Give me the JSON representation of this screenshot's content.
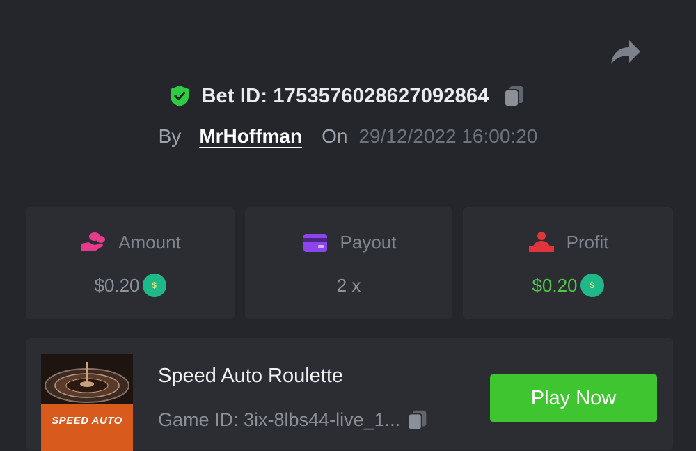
{
  "bet": {
    "id_label": "Bet ID: 1753576028627092864",
    "by_label": "By",
    "username": "MrHoffman",
    "on_label": "On",
    "datetime": "29/12/2022 16:00:20"
  },
  "stats": [
    {
      "label": "Amount",
      "value": "$0.20",
      "icon": "coins-hand-icon",
      "color": "#e63a8c",
      "has_coin": true
    },
    {
      "label": "Payout",
      "value": "2 x",
      "icon": "wallet-card-icon",
      "color": "#8b45e8",
      "has_coin": false
    },
    {
      "label": "Profit",
      "value": "$0.20",
      "icon": "profit-person-icon",
      "color": "#e0353c",
      "has_coin": true
    }
  ],
  "game": {
    "title": "Speed Auto Roulette",
    "game_id": "Game ID: 3ix-8lbs44-live_1...",
    "thumbnail_caption": "SPEED AUTO",
    "play_label": "Play Now"
  },
  "colors": {
    "background": "#24262b",
    "card": "#2b2d33",
    "accent_green": "#3fc530",
    "shield_green": "#2ecc40",
    "profit_green": "#52c64a",
    "coin": "#1fb888"
  }
}
